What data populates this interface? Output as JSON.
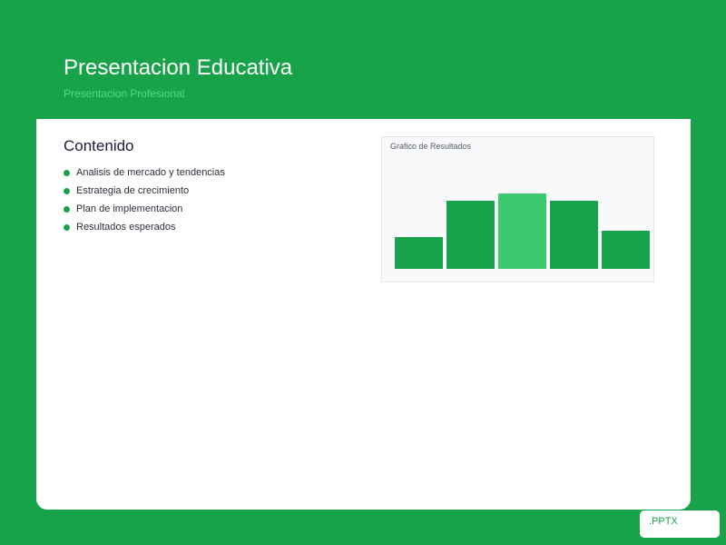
{
  "slide": {
    "title": "Presentacion Educativa",
    "subtitle": "Presentacion Profesional"
  },
  "contents": {
    "heading": "Contenido",
    "items": [
      "Analisis de mercado y tendencias",
      "Estrategia de crecimiento",
      "Plan de implementacion",
      "Resultados esperados"
    ]
  },
  "chart_data": {
    "type": "bar",
    "title": "Grafico de Resultados",
    "categories": [
      "",
      "",
      "",
      "",
      ""
    ],
    "values": [
      35,
      75,
      83,
      75,
      42
    ],
    "ylim": [
      0,
      100
    ],
    "highlight_index": 2,
    "colors": {
      "bar": "#18a34a",
      "highlight": "#3ec96f"
    },
    "grid": false,
    "legend": "none"
  },
  "badge": {
    "label": ".PPTX"
  },
  "colors": {
    "background": "#18a34a",
    "accent_light": "#4ade80",
    "card": "#ffffff"
  }
}
